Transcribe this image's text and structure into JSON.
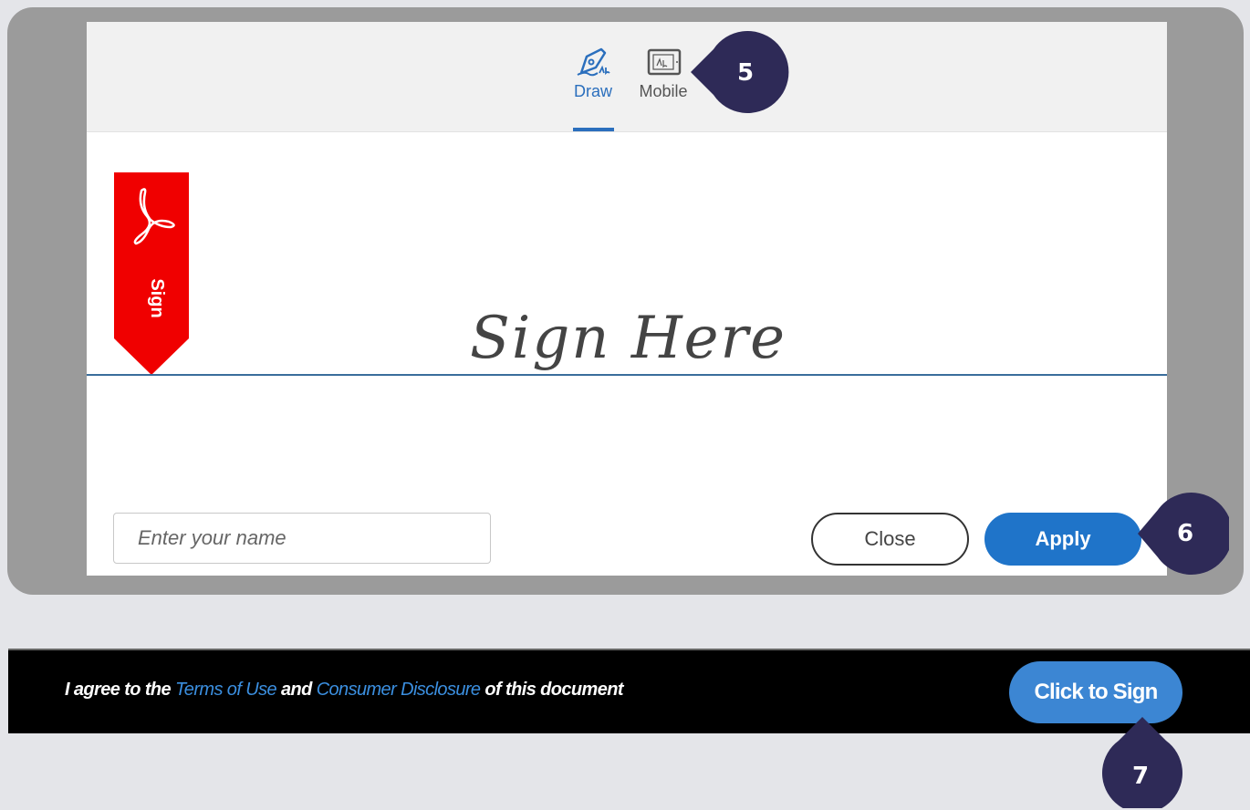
{
  "signature_dialog": {
    "tabs": [
      {
        "label": "Draw",
        "icon": "pen-draw-icon",
        "selected": true
      },
      {
        "label": "Mobile",
        "icon": "mobile-tablet-icon",
        "selected": false
      }
    ],
    "ribbon_text": "Sign",
    "ribbon_icon": "acrobat-logo-icon",
    "sign_here_text": "Sign Here",
    "name_input": {
      "placeholder": "Enter your name",
      "value": ""
    },
    "close_label": "Close",
    "apply_label": "Apply"
  },
  "footer": {
    "agree_prefix": "I agree to the ",
    "terms_link": "Terms of Use",
    "agree_middle": " and ",
    "disclosure_link": "Consumer Disclosure",
    "agree_suffix": " of this document",
    "click_to_sign_label": "Click to Sign"
  },
  "callouts": [
    "5",
    "6",
    "7"
  ],
  "colors": {
    "accent_blue": "#1f74c9",
    "ribbon_red": "#f00000",
    "callout_navy": "#2e2a57",
    "frame_gray": "#9b9b9b"
  }
}
